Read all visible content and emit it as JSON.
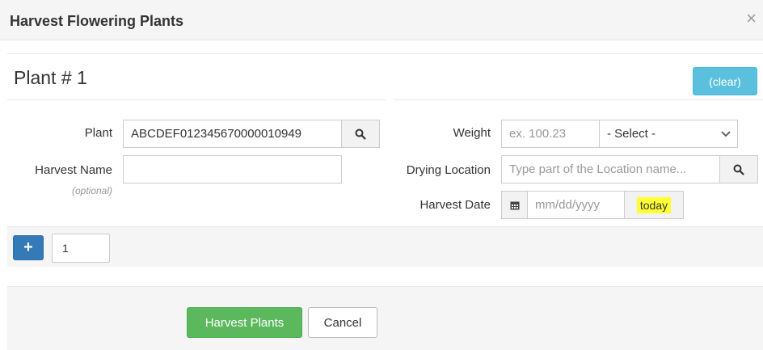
{
  "header": {
    "title": "Harvest Flowering Plants",
    "close_glyph": "×"
  },
  "panel": {
    "plant_title": "Plant # 1",
    "clear_label": "(clear)"
  },
  "fields": {
    "plant": {
      "label": "Plant",
      "value": "ABCDEF012345670000010949"
    },
    "harvest_name": {
      "label": "Harvest Name",
      "sublabel": "(optional)",
      "value": ""
    },
    "weight": {
      "label": "Weight",
      "placeholder": "ex. 100.23",
      "unit_selected": "- Select -"
    },
    "drying_location": {
      "label": "Drying Location",
      "placeholder": "Type part of the Location name..."
    },
    "harvest_date": {
      "label": "Harvest Date",
      "placeholder": "mm/dd/yyyy",
      "today_label": "today"
    }
  },
  "counter": {
    "add_glyph": "+",
    "value": "1"
  },
  "footer": {
    "harvest_label": "Harvest Plants",
    "cancel_label": "Cancel"
  },
  "colors": {
    "info": "#5bc0de",
    "primary": "#337ab7",
    "success": "#5cb85c",
    "highlight": "#ffff33"
  }
}
